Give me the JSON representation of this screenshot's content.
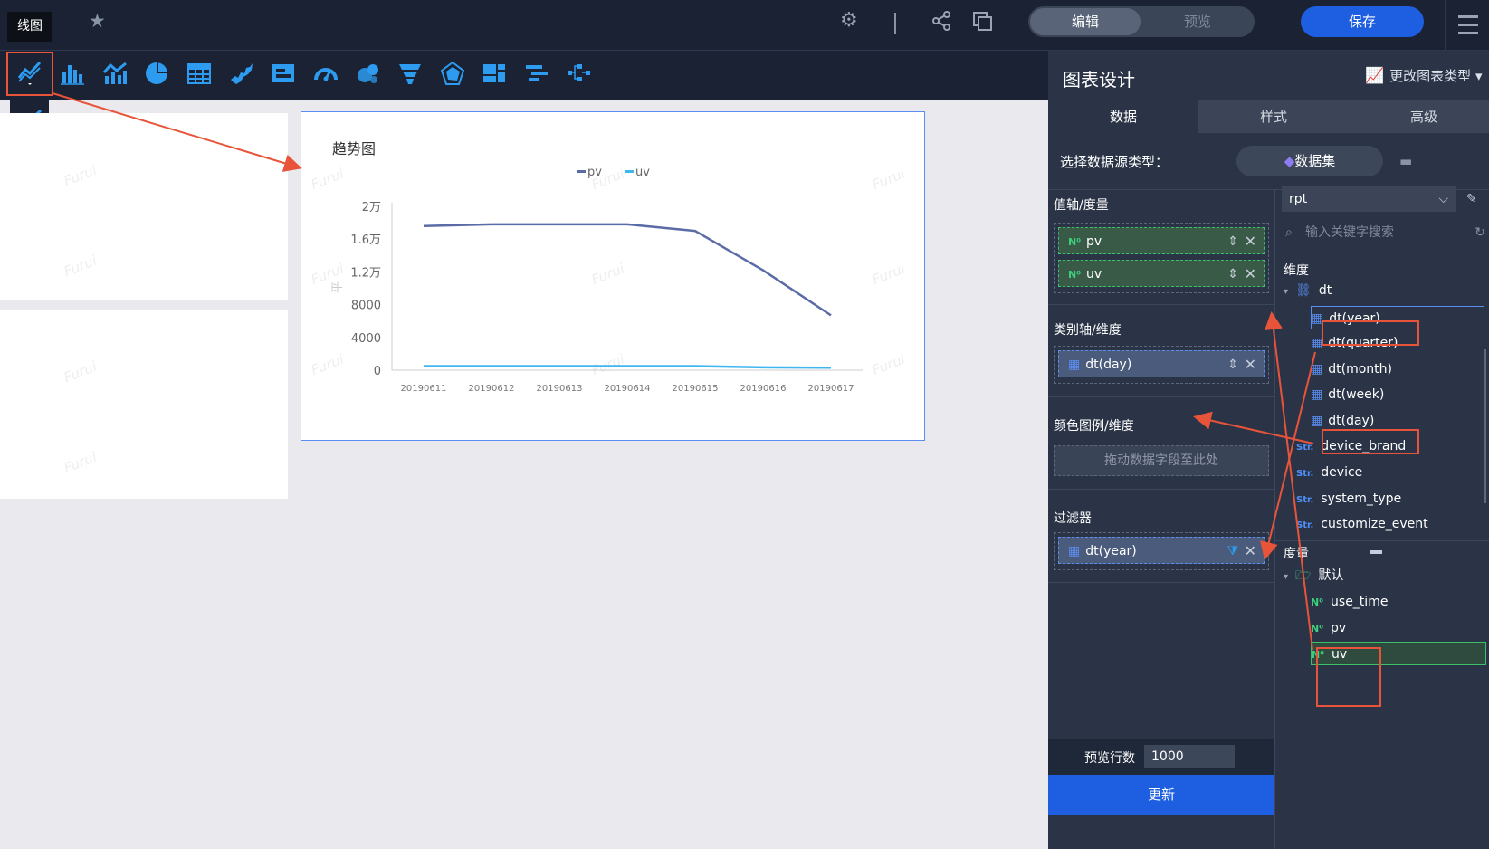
{
  "topbar": {
    "tooltip": "线图",
    "mode_edit": "编辑",
    "mode_preview": "预览",
    "save": "保存"
  },
  "chart": {
    "title": "趋势图",
    "watermark": "Furui",
    "y_axis_label_partial": "平"
  },
  "chart_data": {
    "type": "line",
    "title": "趋势图",
    "x": [
      "20190611",
      "20190612",
      "20190613",
      "20190614",
      "20190615",
      "20190616",
      "20190617"
    ],
    "y_ticks": [
      "0",
      "4000",
      "8000",
      "1.2万",
      "1.6万",
      "2万"
    ],
    "ylim": [
      0,
      20000
    ],
    "series": [
      {
        "name": "pv",
        "color": "#5b6ba6",
        "values": [
          17600,
          17800,
          17800,
          17800,
          17000,
          12200,
          6700
        ]
      },
      {
        "name": "uv",
        "color": "#3fb6f0",
        "values": [
          500,
          500,
          500,
          500,
          500,
          350,
          300
        ]
      }
    ],
    "legend_position": "top-center",
    "grid": false
  },
  "panel": {
    "title": "图表设计",
    "change_type": "更改图表类型",
    "tabs": [
      "数据",
      "样式",
      "高级"
    ],
    "ds_label": "选择数据源类型：",
    "ds_button": "数据集",
    "sections": {
      "value_axis": "值轴/度量",
      "category_axis": "类别轴/维度",
      "color_legend": "颜色图例/维度",
      "filter": "过滤器"
    },
    "value_chips": [
      "pv",
      "uv"
    ],
    "category_chip": "dt(day)",
    "drop_hint": "拖动数据字段至此处",
    "filter_chip": "dt(year)",
    "preview_label": "预览行数",
    "preview_value": "1000",
    "update": "更新"
  },
  "fields": {
    "dataset": "rpt",
    "search_placeholder": "输入关键字搜索",
    "dimension_title": "维度",
    "dim_root": "dt",
    "dates": [
      "dt(year)",
      "dt(quarter)",
      "dt(month)",
      "dt(week)",
      "dt(day)"
    ],
    "strings": [
      "device_brand",
      "device",
      "system_type",
      "customize_event"
    ],
    "measure_title": "度量",
    "measure_folder": "默认",
    "measures": [
      "use_time",
      "pv",
      "uv"
    ]
  },
  "icons": {
    "badge_num": "N⁰",
    "badge_str": "Str."
  },
  "colors": {
    "accent": "#1e5ee0",
    "highlight": "#e8543a",
    "pv": "#5b6ba6",
    "uv": "#3fb6f0"
  }
}
